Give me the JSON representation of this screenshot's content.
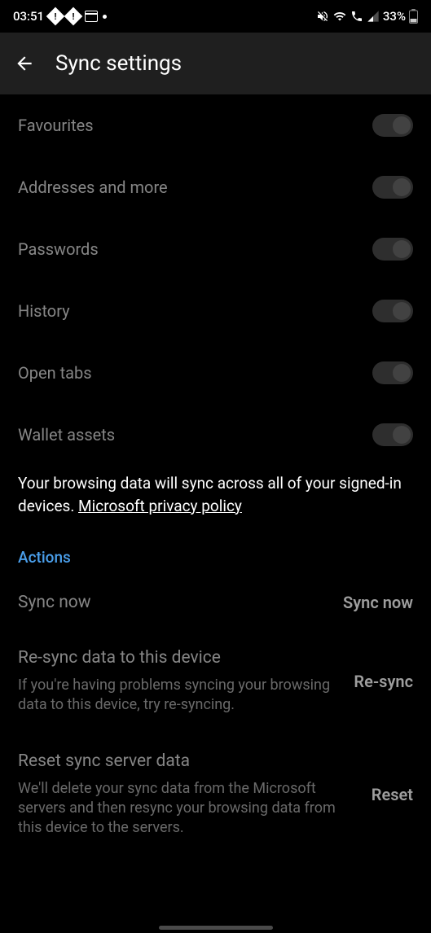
{
  "status": {
    "time": "03:51",
    "battery": "33%"
  },
  "header": {
    "title": "Sync settings"
  },
  "toggles": [
    {
      "label": "Favourites"
    },
    {
      "label": "Addresses and more"
    },
    {
      "label": "Passwords"
    },
    {
      "label": "History"
    },
    {
      "label": "Open tabs"
    },
    {
      "label": "Wallet assets"
    }
  ],
  "info": {
    "text": "Your browsing data will sync across all of your signed-in devices. ",
    "link": "Microsoft privacy policy"
  },
  "actions": {
    "header": "Actions",
    "items": [
      {
        "title": "Sync now",
        "desc": "",
        "button": "Sync now"
      },
      {
        "title": "Re-sync data to this device",
        "desc": "If you're having problems syncing your browsing data to this device, try re-syncing.",
        "button": "Re-sync"
      },
      {
        "title": "Reset sync server data",
        "desc": "We'll delete your sync data from the Microsoft servers and then resync your browsing data from this device to the servers.",
        "button": "Reset"
      }
    ]
  }
}
